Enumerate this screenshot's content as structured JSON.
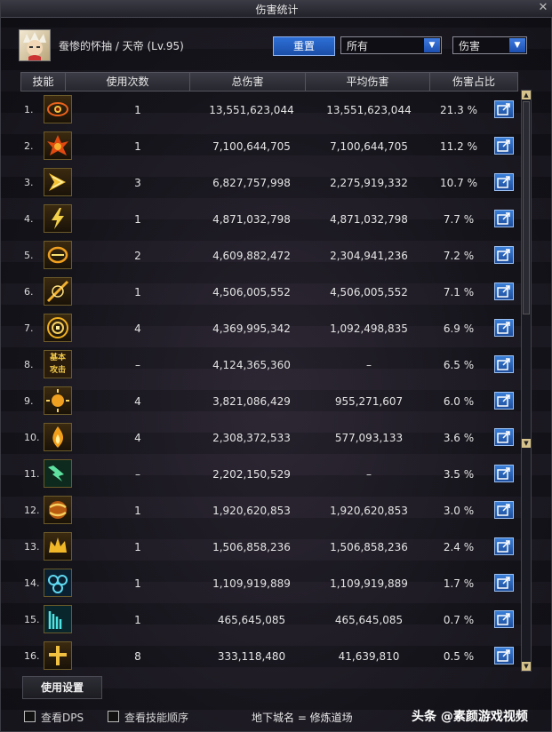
{
  "window": {
    "title": "伤害统计"
  },
  "character": {
    "name_line": "蚕惨的怀抽 / 天帝 (Lv.95)"
  },
  "controls": {
    "reset_label": "重置",
    "filter_value": "所有",
    "metric_value": "伤害"
  },
  "table": {
    "headers": [
      "技能",
      "使用次数",
      "总伤害",
      "平均伤害",
      "伤害占比"
    ],
    "rows": [
      {
        "rank": "1.",
        "uses": "1",
        "total": "13,551,623,044",
        "avg": "13,551,623,044",
        "pct": "21.3 %",
        "icon": "eye-skill-icon"
      },
      {
        "rank": "2.",
        "uses": "1",
        "total": "7,100,644,705",
        "avg": "7,100,644,705",
        "pct": "11.2 %",
        "icon": "flame-burst-skill-icon"
      },
      {
        "rank": "3.",
        "uses": "3",
        "total": "6,827,757,998",
        "avg": "2,275,919,332",
        "pct": "10.7 %",
        "icon": "arrow-slash-skill-icon"
      },
      {
        "rank": "4.",
        "uses": "1",
        "total": "4,871,032,798",
        "avg": "4,871,032,798",
        "pct": "7.7 %",
        "icon": "lightning-skill-icon"
      },
      {
        "rank": "5.",
        "uses": "2",
        "total": "4,609,882,472",
        "avg": "2,304,941,236",
        "pct": "7.2 %",
        "icon": "fire-eye-skill-icon"
      },
      {
        "rank": "6.",
        "uses": "1",
        "total": "4,506,005,552",
        "avg": "4,506,005,552",
        "pct": "7.1 %",
        "icon": "strike-skill-icon"
      },
      {
        "rank": "7.",
        "uses": "4",
        "total": "4,369,995,342",
        "avg": "1,092,498,835",
        "pct": "6.9 %",
        "icon": "seal-skill-icon"
      },
      {
        "rank": "8.",
        "uses": "–",
        "total": "4,124,365,360",
        "avg": "–",
        "pct": "6.5 %",
        "icon": "basic-attack-icon",
        "icon_text": "基本\n攻击"
      },
      {
        "rank": "9.",
        "uses": "4",
        "total": "3,821,086,429",
        "avg": "955,271,607",
        "pct": "6.0 %",
        "icon": "sun-skill-icon"
      },
      {
        "rank": "10.",
        "uses": "4",
        "total": "2,308,372,533",
        "avg": "577,093,133",
        "pct": "3.6 %",
        "icon": "flame-skill-icon"
      },
      {
        "rank": "11.",
        "uses": "–",
        "total": "2,202,150,529",
        "avg": "–",
        "pct": "3.5 %",
        "icon": "green-bolt-skill-icon"
      },
      {
        "rank": "12.",
        "uses": "1",
        "total": "1,920,620,853",
        "avg": "1,920,620,853",
        "pct": "3.0 %",
        "icon": "orb-skill-icon"
      },
      {
        "rank": "13.",
        "uses": "1",
        "total": "1,506,858,236",
        "avg": "1,506,858,236",
        "pct": "2.4 %",
        "icon": "crown-skill-icon"
      },
      {
        "rank": "14.",
        "uses": "1",
        "total": "1,109,919,889",
        "avg": "1,109,919,889",
        "pct": "1.7 %",
        "icon": "cyan-rings-skill-icon"
      },
      {
        "rank": "15.",
        "uses": "1",
        "total": "465,645,085",
        "avg": "465,645,085",
        "pct": "0.7 %",
        "icon": "cyan-wave-skill-icon"
      },
      {
        "rank": "16.",
        "uses": "8",
        "total": "333,118,480",
        "avg": "41,639,810",
        "pct": "0.5 %",
        "icon": "gold-cross-skill-icon"
      }
    ]
  },
  "settings_label": "使用设置",
  "footer": {
    "check_dps": "查看DPS",
    "check_order": "查看技能顺序",
    "dungeon": "地下城名 = 修炼道场",
    "watermark": "头条 @素颜游戏视频"
  },
  "colors": {
    "accent_blue": "#2d6fd6",
    "gold": "#d6c28b"
  }
}
